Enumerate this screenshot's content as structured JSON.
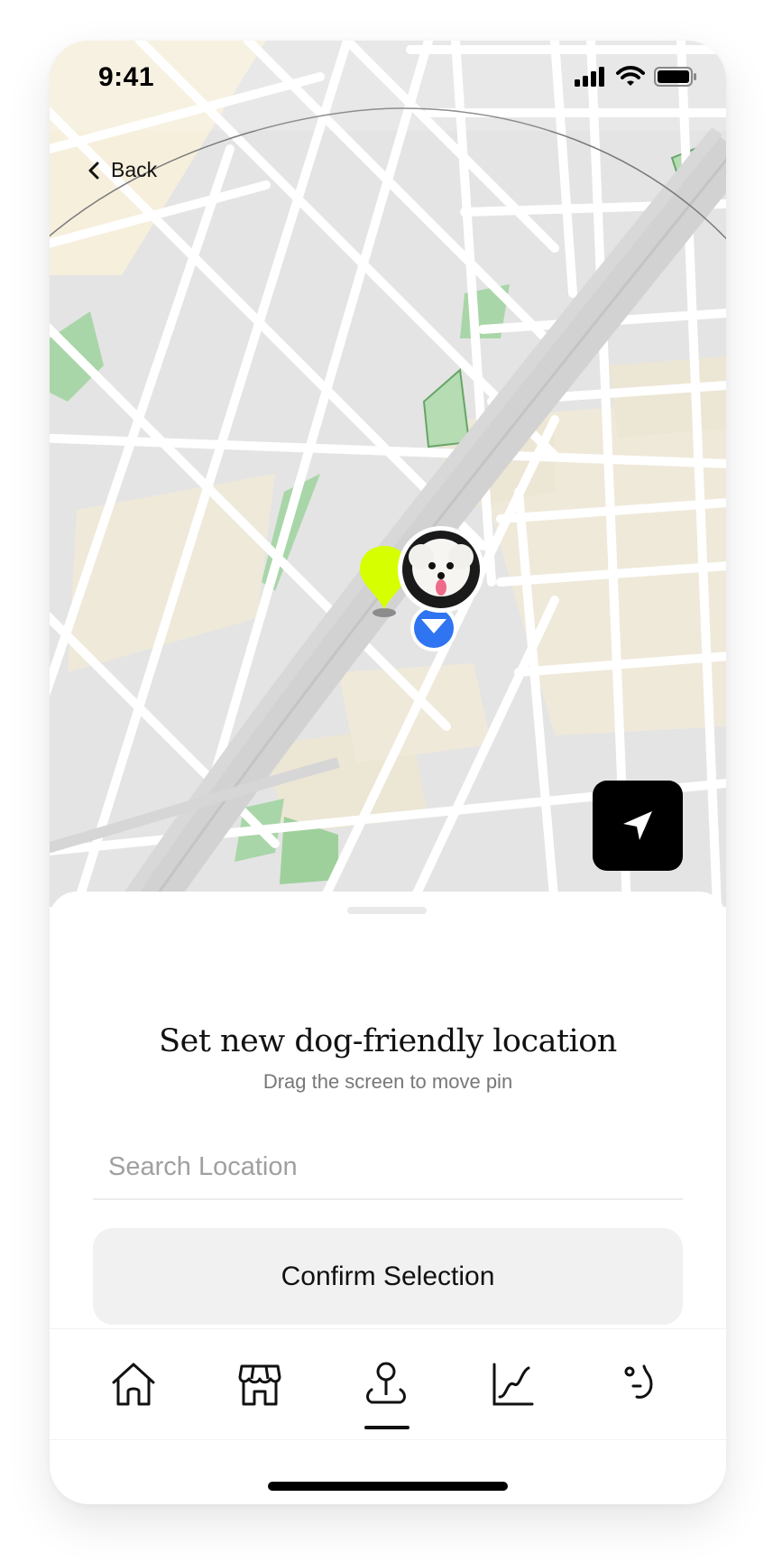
{
  "status_bar": {
    "time": "9:41",
    "icons": [
      "cellular-signal-icon",
      "wifi-icon",
      "battery-icon"
    ]
  },
  "nav": {
    "back_label": "Back",
    "back_icon": "chevron-left-icon"
  },
  "map": {
    "user_pin_color": "#d6ff00",
    "dog_marker_color": "#2f74f0",
    "dog_avatar": "dog-avatar",
    "locate_button_icon": "navigation-arrow-icon"
  },
  "sheet": {
    "title": "Set new dog-friendly location",
    "subtitle": "Drag the screen to move pin",
    "search": {
      "placeholder": "Search Location",
      "value": ""
    },
    "confirm_label": "Confirm Selection"
  },
  "tab_bar": {
    "tabs": [
      {
        "icon": "home-icon",
        "active": false
      },
      {
        "icon": "store-icon",
        "active": false
      },
      {
        "icon": "location-pin-icon",
        "active": true
      },
      {
        "icon": "chart-icon",
        "active": false
      },
      {
        "icon": "smiley-face-icon",
        "active": false
      }
    ]
  },
  "colors": {
    "accent_pin": "#d6ff00",
    "map_road": "#ffffff",
    "map_block": "#e5e5e5",
    "map_park": "#a7d7a9",
    "map_sand": "#f2ecdb"
  }
}
